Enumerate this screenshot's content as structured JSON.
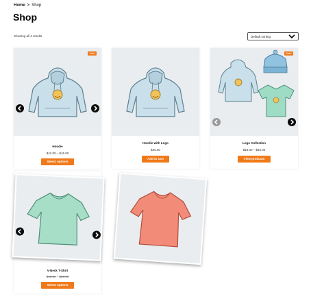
{
  "breadcrumb": {
    "home": "Home",
    "separator": ">",
    "current": "Shop"
  },
  "page": {
    "title": "Shop"
  },
  "results": {
    "text": "Showing all 4 results"
  },
  "sorting": {
    "selected": "Default sorting"
  },
  "products": [
    {
      "name": "Hoodie",
      "price": "$42.00 – $45.00",
      "button": "Select options",
      "badge": "Sale!"
    },
    {
      "name": "Hoodie with Logo",
      "price": "$45.00",
      "button": "Add to cart"
    },
    {
      "name": "Logo Collection",
      "price": "$18.00 – $45.00",
      "button": "View products",
      "badge": "Sale!"
    },
    {
      "name": "V-Neck T-Shirt",
      "price_old": "$15.00",
      "price_sep": " – ",
      "price_new": "$20.00",
      "button": "Select options"
    }
  ],
  "colors": {
    "accent": "#f07a1a",
    "image_bg": "#e9edf0",
    "arrow": "#0b0b0b"
  },
  "icons": {
    "prev": "chevron-left-icon",
    "next": "chevron-right-icon",
    "select": "chevron-down-icon"
  }
}
